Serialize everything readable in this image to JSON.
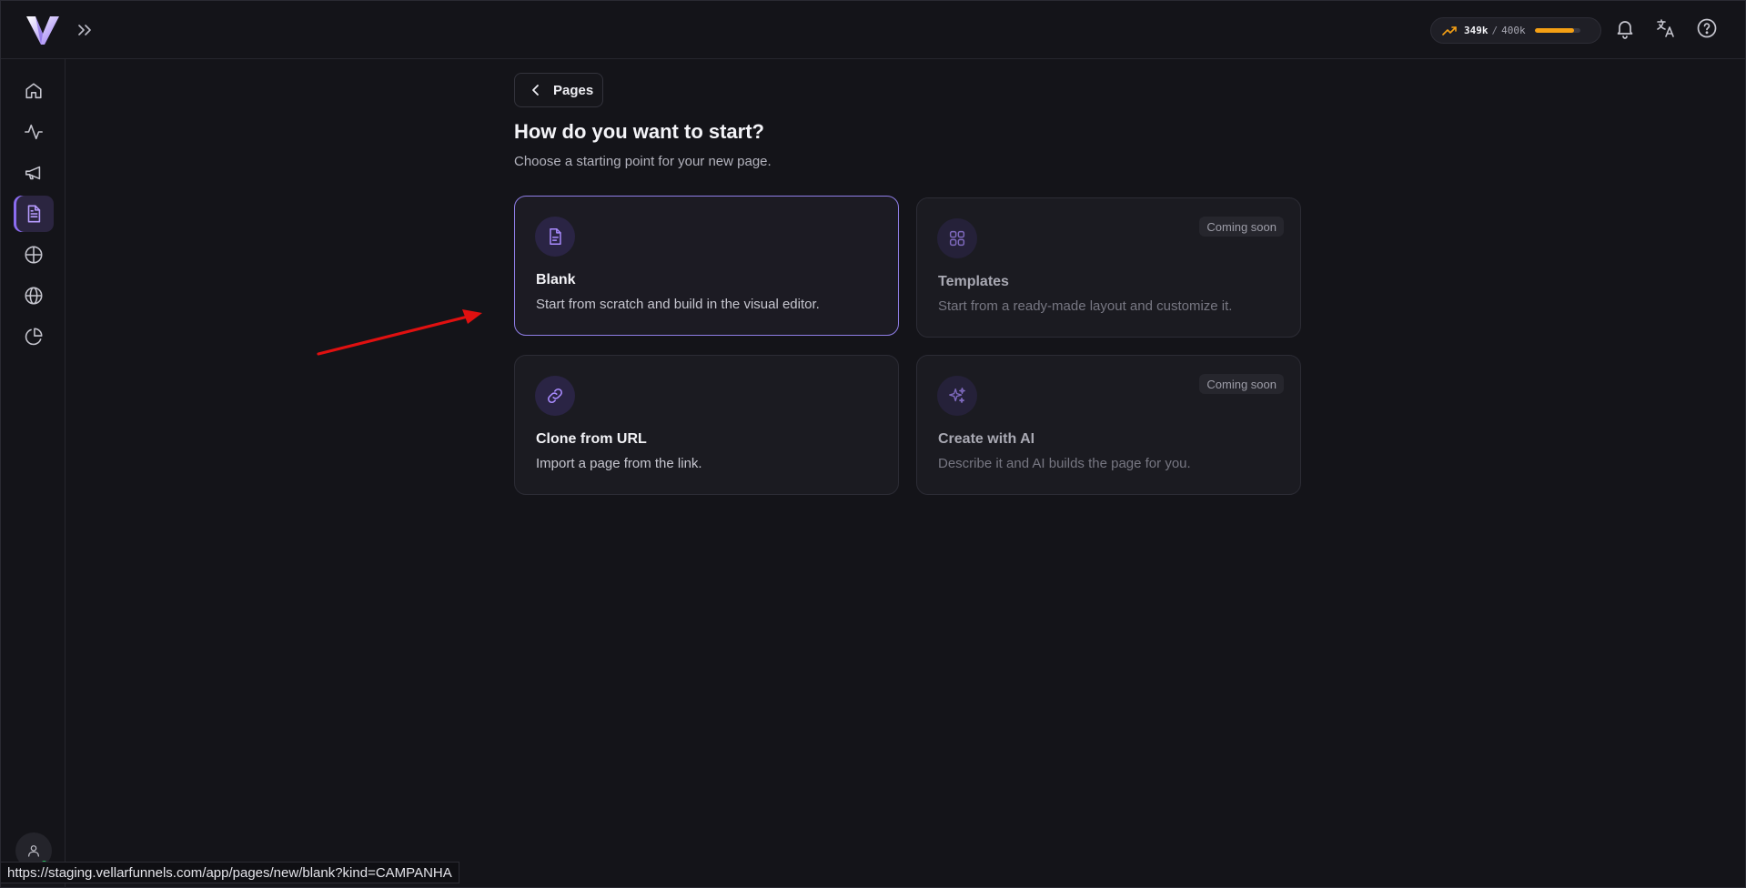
{
  "header": {
    "logo_icon": "vellar-logo-icon",
    "expand_icon": "chevrons-right-icon",
    "credits": {
      "used": "349k",
      "separator": "/",
      "total": "400k",
      "usage_fraction": 0.87,
      "accent": "#f5a014"
    },
    "icons": [
      "bell-icon",
      "translate-icon",
      "help-circle-icon"
    ]
  },
  "sidebar": {
    "items": [
      {
        "name": "home",
        "icon": "home-icon"
      },
      {
        "name": "analytics",
        "icon": "activity-icon"
      },
      {
        "name": "campaigns",
        "icon": "megaphone-icon"
      },
      {
        "name": "pages",
        "icon": "file-text-icon",
        "active": true
      },
      {
        "name": "integrations",
        "icon": "globe-grid-icon"
      },
      {
        "name": "domains",
        "icon": "globe-icon"
      },
      {
        "name": "reports",
        "icon": "pie-chart-icon"
      }
    ],
    "avatar_icon": "user-icon"
  },
  "main": {
    "back_label": "Pages",
    "title": "How do you want to start?",
    "subtitle": "Choose a starting point for your new page.",
    "cards": [
      {
        "title": "Blank",
        "description": "Start from scratch and build in the visual editor.",
        "icon": "file-icon",
        "badge": ""
      },
      {
        "title": "Templates",
        "description": "Start from a ready-made layout and customize it.",
        "icon": "grid-icon",
        "badge": "Coming soon"
      },
      {
        "title": "Clone from URL",
        "description": "Import a page from the link.",
        "icon": "link-icon",
        "badge": ""
      },
      {
        "title": "Create with AI",
        "description": "Describe it and AI builds the page for you.",
        "icon": "sparkles-icon",
        "badge": "Coming soon"
      }
    ]
  },
  "status_url": "https://staging.vellarfunnels.com/app/pages/new/blank?kind=CAMPANHA",
  "colors": {
    "background": "#141419",
    "accent": "#8f7ee6",
    "annotation": "#e01010"
  }
}
